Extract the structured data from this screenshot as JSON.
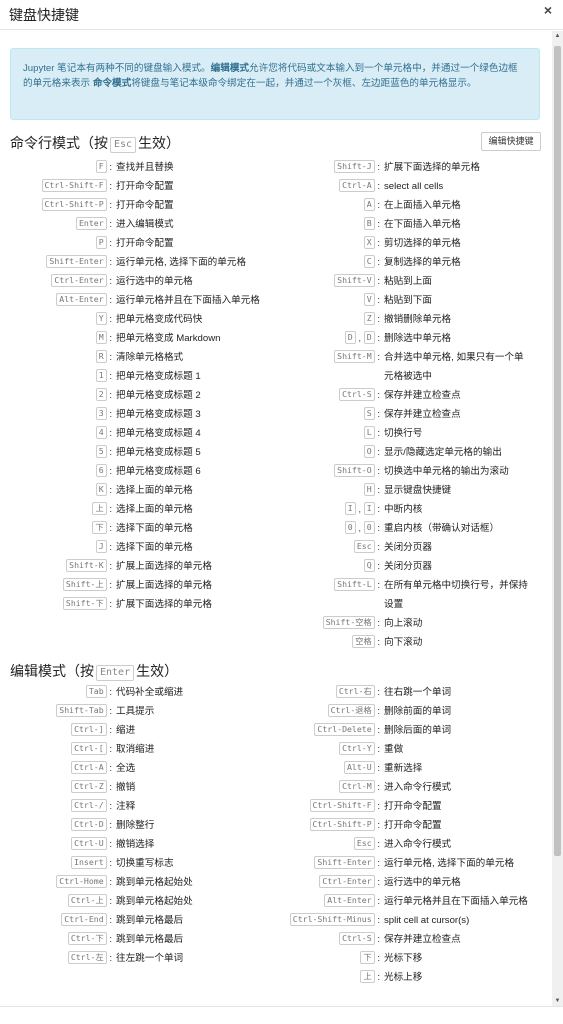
{
  "dialog": {
    "title": "键盘快捷键",
    "close": "×",
    "info_parts": {
      "a": "Jupyter 笔记本有两种不同的键盘输入模式。",
      "b": "编辑模式",
      "c": "允许您将代码或文本输入到一个单元格中，并通过一个绿色边框的单元格来表示",
      "d": "命令模式",
      "e": "将键盘与笔记本级命令绑定在一起，并通过一个灰框、左边距蓝色的单元格显示。"
    },
    "command_title": {
      "pre": "命令行模式（按",
      "key": "Esc",
      "post": "生效）"
    },
    "edit_button": "编辑快捷键",
    "edit_title": {
      "pre": "编辑模式（按",
      "key": "Enter",
      "post": "生效）"
    }
  },
  "command_left": [
    {
      "keys": [
        "F"
      ],
      "desc": "查找并且替换"
    },
    {
      "keys": [
        "Ctrl-Shift-F"
      ],
      "desc": "打开命令配置"
    },
    {
      "keys": [
        "Ctrl-Shift-P"
      ],
      "desc": "打开命令配置"
    },
    {
      "keys": [
        "Enter"
      ],
      "desc": "进入编辑模式"
    },
    {
      "keys": [
        "P"
      ],
      "desc": "打开命令配置"
    },
    {
      "keys": [
        "Shift-Enter"
      ],
      "desc": "运行单元格, 选择下面的单元格"
    },
    {
      "keys": [
        "Ctrl-Enter"
      ],
      "desc": "运行选中的单元格"
    },
    {
      "keys": [
        "Alt-Enter"
      ],
      "desc": "运行单元格并且在下面插入单元格"
    },
    {
      "keys": [
        "Y"
      ],
      "desc": "把单元格变成代码快"
    },
    {
      "keys": [
        "M"
      ],
      "desc": "把单元格变成 Markdown"
    },
    {
      "keys": [
        "R"
      ],
      "desc": "清除单元格格式"
    },
    {
      "keys": [
        "1"
      ],
      "desc": "把单元格变成标题 1"
    },
    {
      "keys": [
        "2"
      ],
      "desc": "把单元格变成标题 2"
    },
    {
      "keys": [
        "3"
      ],
      "desc": "把单元格变成标题 3"
    },
    {
      "keys": [
        "4"
      ],
      "desc": "把单元格变成标题 4"
    },
    {
      "keys": [
        "5"
      ],
      "desc": "把单元格变成标题 5"
    },
    {
      "keys": [
        "6"
      ],
      "desc": "把单元格变成标题 6"
    },
    {
      "keys": [
        "K"
      ],
      "desc": "选择上面的单元格"
    },
    {
      "keys": [
        "上"
      ],
      "desc": "选择上面的单元格"
    },
    {
      "keys": [
        "下"
      ],
      "desc": "选择下面的单元格"
    },
    {
      "keys": [
        "J"
      ],
      "desc": "选择下面的单元格"
    },
    {
      "keys": [
        "Shift-K"
      ],
      "desc": "扩展上面选择的单元格"
    },
    {
      "keys": [
        "Shift-上"
      ],
      "desc": "扩展上面选择的单元格"
    },
    {
      "keys": [
        "Shift-下"
      ],
      "desc": "扩展下面选择的单元格"
    }
  ],
  "command_right": [
    {
      "keys": [
        "Shift-J"
      ],
      "desc": "扩展下面选择的单元格"
    },
    {
      "keys": [
        "Ctrl-A"
      ],
      "desc": "select all cells"
    },
    {
      "keys": [
        "A"
      ],
      "desc": "在上面插入单元格"
    },
    {
      "keys": [
        "B"
      ],
      "desc": "在下面插入单元格"
    },
    {
      "keys": [
        "X"
      ],
      "desc": "剪切选择的单元格"
    },
    {
      "keys": [
        "C"
      ],
      "desc": "复制选择的单元格"
    },
    {
      "keys": [
        "Shift-V"
      ],
      "desc": "粘贴到上面"
    },
    {
      "keys": [
        "V"
      ],
      "desc": "粘贴到下面"
    },
    {
      "keys": [
        "Z"
      ],
      "desc": "撤销删除单元格"
    },
    {
      "keys": [
        "D",
        "D"
      ],
      "desc": "删除选中单元格"
    },
    {
      "keys": [
        "Shift-M"
      ],
      "desc": "合并选中单元格, 如果只有一个单元格被选中"
    },
    {
      "keys": [
        "Ctrl-S"
      ],
      "desc": "保存并建立检查点"
    },
    {
      "keys": [
        "S"
      ],
      "desc": "保存并建立检查点"
    },
    {
      "keys": [
        "L"
      ],
      "desc": "切换行号"
    },
    {
      "keys": [
        "O"
      ],
      "desc": "显示/隐藏选定单元格的输出"
    },
    {
      "keys": [
        "Shift-O"
      ],
      "desc": "切换选中单元格的输出为滚动"
    },
    {
      "keys": [
        "H"
      ],
      "desc": "显示键盘快捷键"
    },
    {
      "keys": [
        "I",
        "I"
      ],
      "desc": "中断内核"
    },
    {
      "keys": [
        "0",
        "0"
      ],
      "desc": "重启内核（带确认对话框）"
    },
    {
      "keys": [
        "Esc"
      ],
      "desc": "关闭分页器"
    },
    {
      "keys": [
        "Q"
      ],
      "desc": "关闭分页器"
    },
    {
      "keys": [
        "Shift-L"
      ],
      "desc": "在所有单元格中切换行号，并保持设置"
    },
    {
      "keys": [
        "Shift-空格"
      ],
      "desc": "向上滚动"
    },
    {
      "keys": [
        "空格"
      ],
      "desc": "向下滚动"
    }
  ],
  "edit_left": [
    {
      "keys": [
        "Tab"
      ],
      "desc": "代码补全或缩进"
    },
    {
      "keys": [
        "Shift-Tab"
      ],
      "desc": "工具提示"
    },
    {
      "keys": [
        "Ctrl-]"
      ],
      "desc": "缩进"
    },
    {
      "keys": [
        "Ctrl-["
      ],
      "desc": "取消缩进"
    },
    {
      "keys": [
        "Ctrl-A"
      ],
      "desc": "全选"
    },
    {
      "keys": [
        "Ctrl-Z"
      ],
      "desc": "撤销"
    },
    {
      "keys": [
        "Ctrl-/"
      ],
      "desc": "注释"
    },
    {
      "keys": [
        "Ctrl-D"
      ],
      "desc": "删除整行"
    },
    {
      "keys": [
        "Ctrl-U"
      ],
      "desc": "撤销选择"
    },
    {
      "keys": [
        "Insert"
      ],
      "desc": "切换重写标志"
    },
    {
      "keys": [
        "Ctrl-Home"
      ],
      "desc": "跳到单元格起始处"
    },
    {
      "keys": [
        "Ctrl-上"
      ],
      "desc": "跳到单元格起始处"
    },
    {
      "keys": [
        "Ctrl-End"
      ],
      "desc": "跳到单元格最后"
    },
    {
      "keys": [
        "Ctrl-下"
      ],
      "desc": "跳到单元格最后"
    },
    {
      "keys": [
        "Ctrl-左"
      ],
      "desc": "往左跳一个单词"
    }
  ],
  "edit_right": [
    {
      "keys": [
        "Ctrl-右"
      ],
      "desc": "往右跳一个单词"
    },
    {
      "keys": [
        "Ctrl-退格"
      ],
      "desc": "删除前面的单词"
    },
    {
      "keys": [
        "Ctrl-Delete"
      ],
      "desc": "删除后面的单词"
    },
    {
      "keys": [
        "Ctrl-Y"
      ],
      "desc": "重做"
    },
    {
      "keys": [
        "Alt-U"
      ],
      "desc": "重新选择"
    },
    {
      "keys": [
        "Ctrl-M"
      ],
      "desc": "进入命令行模式"
    },
    {
      "keys": [
        "Ctrl-Shift-F"
      ],
      "desc": "打开命令配置"
    },
    {
      "keys": [
        "Ctrl-Shift-P"
      ],
      "desc": "打开命令配置"
    },
    {
      "keys": [
        "Esc"
      ],
      "desc": "进入命令行模式"
    },
    {
      "keys": [
        "Shift-Enter"
      ],
      "desc": "运行单元格, 选择下面的单元格"
    },
    {
      "keys": [
        "Ctrl-Enter"
      ],
      "desc": "运行选中的单元格"
    },
    {
      "keys": [
        "Alt-Enter"
      ],
      "desc": "运行单元格并且在下面插入单元格"
    },
    {
      "keys": [
        "Ctrl-Shift-Minus"
      ],
      "desc": "split cell at cursor(s)"
    },
    {
      "keys": [
        "Ctrl-S"
      ],
      "desc": "保存并建立检查点"
    },
    {
      "keys": [
        "下"
      ],
      "desc": "光标下移"
    },
    {
      "keys": [
        "上"
      ],
      "desc": "光标上移"
    }
  ],
  "scrollbar": {
    "up": "▲",
    "down": "▼"
  }
}
